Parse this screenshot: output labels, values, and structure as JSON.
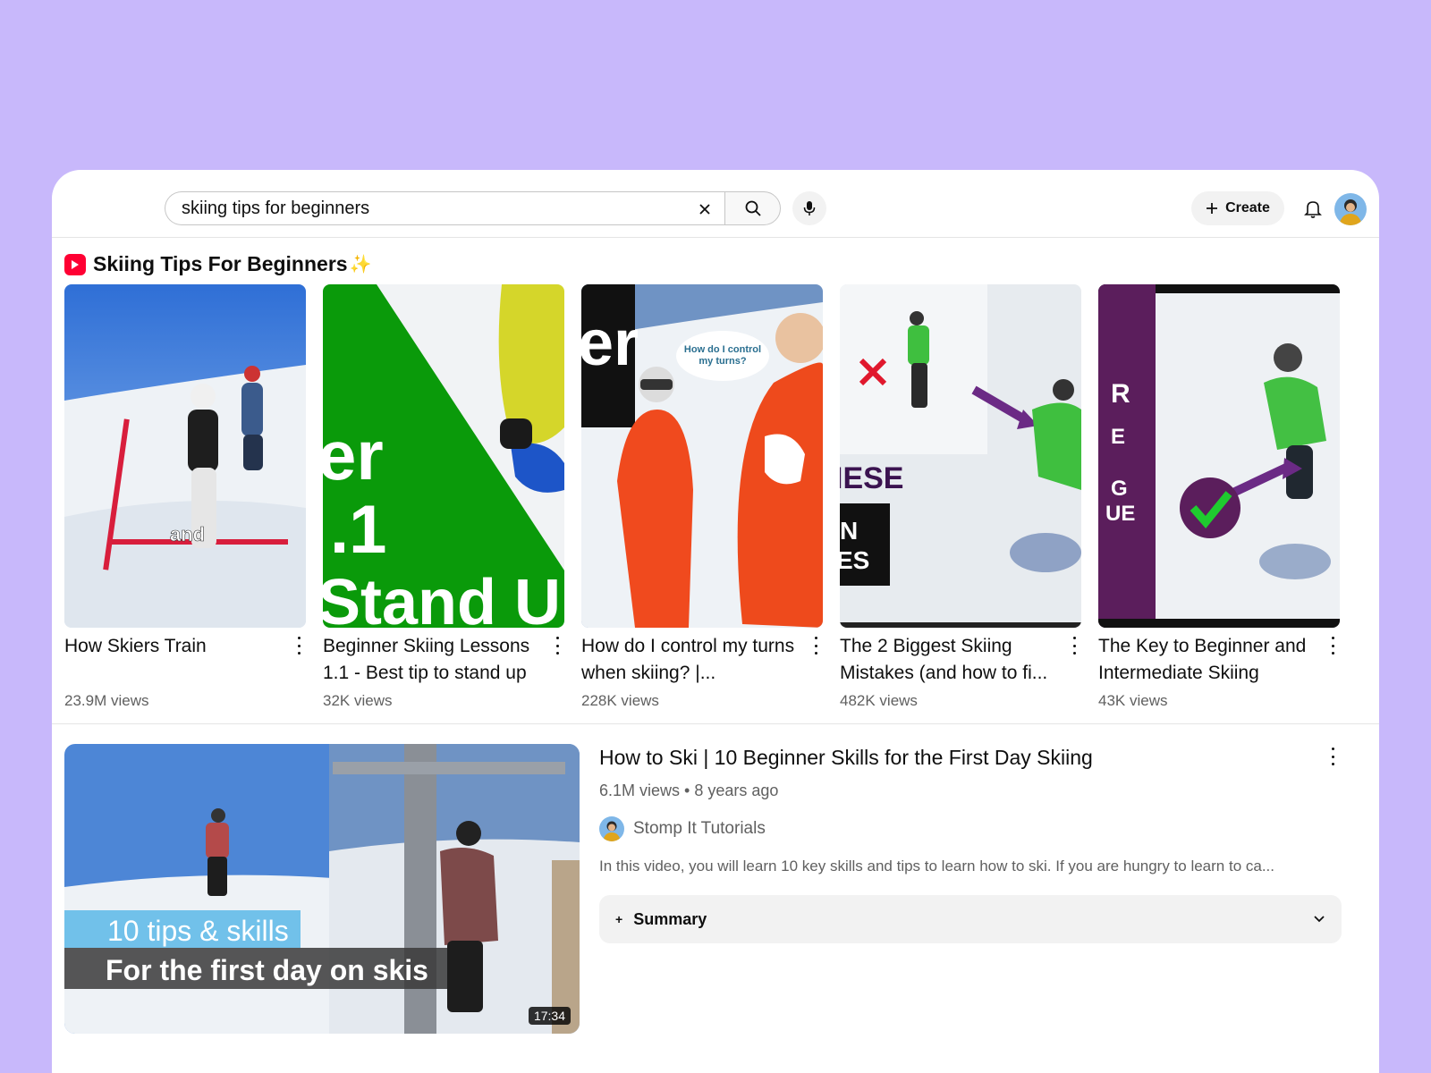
{
  "search": {
    "query": "skiing tips for beginners"
  },
  "header": {
    "create_label": "Create"
  },
  "shelf": {
    "title": "Skiing Tips For Beginners",
    "sparkle": "✨",
    "items": [
      {
        "title": "How Skiers Train",
        "views": "23.9M views",
        "overlay": "and"
      },
      {
        "title": "Beginner Skiing Lessons 1.1 - Best tip to stand up",
        "views": "32K views",
        "overlay_1": "er",
        "overlay_2": ".1",
        "overlay_3": "Stand Up"
      },
      {
        "title": "How do I control my turns when skiing? |...",
        "views": "228K views",
        "overlay_1": "er",
        "overlay_2": "How do I control",
        "overlay_3": "my turns?"
      },
      {
        "title": "The 2 Biggest Skiing Mistakes (and how to fi...",
        "views": "482K views",
        "overlay_1": "IESE",
        "overlay_2": "N",
        "overlay_3": "ES"
      },
      {
        "title": "The Key to Beginner and Intermediate Skiing",
        "views": "43K views",
        "overlay_1": "R",
        "overlay_2": "E",
        "overlay_3": "G",
        "overlay_4": "UE"
      }
    ]
  },
  "video": {
    "title": "How to Ski | 10 Beginner Skills for the First Day Skiing",
    "views": "6.1M views",
    "age": "8 years ago",
    "meta_separator": "•",
    "channel": "Stomp It Tutorials",
    "description": "In this video, you will learn 10 key skills and tips to learn how to ski. If you are hungry to learn to ca...",
    "summary_label": "Summary",
    "summary_icon": "+",
    "duration": "17:34",
    "thumb_caption_1": "10 tips & skills",
    "thumb_caption_2": "For the first day on skis"
  },
  "colors": {
    "background": "#c8b8fb",
    "shorts_red": "#ff0033",
    "text_primary": "#0f0f0f",
    "text_secondary": "#606060"
  }
}
